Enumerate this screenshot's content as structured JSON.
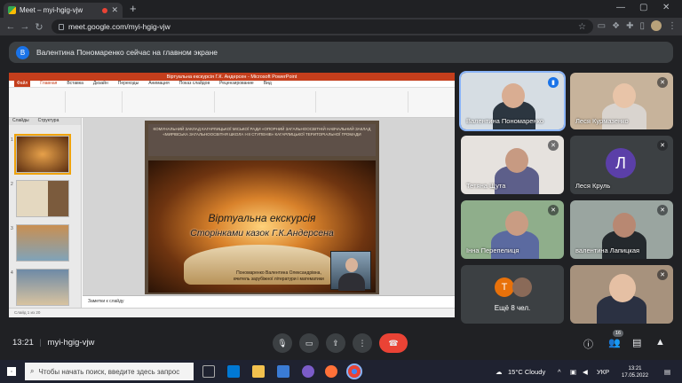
{
  "browser": {
    "tab_title": "Meet – myi-hgig-vjw",
    "url": "meet.google.com/myi-hgig-vjw"
  },
  "banner": {
    "avatar_letter": "В",
    "text": "Валентина Пономаренко сейчас на главном экране"
  },
  "presentation": {
    "window_title": "Віртуальна екскурсія Г.К. Андерсен - Microsoft PowerPoint",
    "ribbon_tabs": [
      "Файл",
      "Главная",
      "Вставка",
      "Дизайн",
      "Переходы",
      "Анимация",
      "Показ слайдов",
      "Рецензирование",
      "Вид"
    ],
    "pane_tabs": [
      "Слайды",
      "Структура"
    ],
    "slide_header": "КОМУНАЛЬНИЙ ЗАКЛАД КАГАРЛИЦЬКОЇ МІСЬКОЇ РАДИ «ОПОРНИЙ ЗАГАЛЬНООСВІТНІЙ НАВЧАЛЬНИЙ ЗАКЛАД «МИРІВСЬКА ЗАГАЛЬНООСВІТНЯ ШКОЛА І-ІІІ СТУПЕНІВ» КАГАРЛИЦЬКОЇ ТЕРИТОРІАЛЬНОЇ ГРОМАДИ",
    "slide_title_1": "Віртуальна екскурсія",
    "slide_title_2": "Сторінками казок Г.К.Андерсена",
    "author": "Пономаренко Валентина Олександрівна, вчитель зарубіжної літератури і математики",
    "notes_placeholder": "Заметки к слайду",
    "status": "Слайд 1 из 20"
  },
  "participants": [
    {
      "name": "Валентина Пономаренко",
      "muted": false,
      "speaking": true
    },
    {
      "name": "Леся Курмазенко",
      "muted": true
    },
    {
      "name": "Тетяна Щута",
      "muted": true
    },
    {
      "name": "Леся Круль",
      "muted": true,
      "avatar_letter": "Л"
    },
    {
      "name": "Інна Перепелиця",
      "muted": true
    },
    {
      "name": "валентина Лапицкая",
      "muted": true
    },
    {
      "name": "Ещё 8 чел.",
      "avatar_letter": "Т"
    },
    {
      "name": "",
      "muted": true
    }
  ],
  "meet_bar": {
    "time": "13:21",
    "separator": "|",
    "meeting_code": "myi-hgig-vjw",
    "people_count": "16"
  },
  "taskbar": {
    "search_placeholder": "Чтобы начать поиск, введите здесь запрос",
    "weather": "15°C  Cloudy",
    "lang": "УКР",
    "time": "13:21",
    "date": "17.05.2022"
  },
  "colors": {
    "meet_dark": "#202124",
    "tile": "#3c4043",
    "end_call": "#ea4335",
    "accent_blue": "#1a73e8",
    "pp_red": "#c43e1c"
  }
}
